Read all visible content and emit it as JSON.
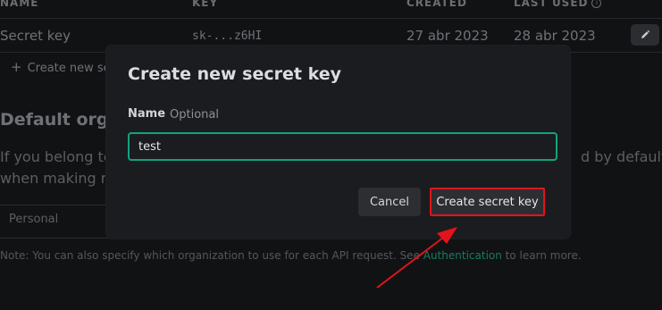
{
  "table": {
    "headers": {
      "name": "NAME",
      "key": "KEY",
      "created": "CREATED",
      "last_used": "LAST USED"
    },
    "rows": [
      {
        "name": "Secret key",
        "key": "sk-...z6HI",
        "created": "27 abr 2023",
        "last_used": "28 abr 2023"
      }
    ],
    "info_icon": "info-circle-icon",
    "edit_icon": "pencil-icon"
  },
  "create_link": {
    "label": "Create new se",
    "icon": "plus-icon"
  },
  "default_org": {
    "title": "Default organ",
    "text_line1_left": "If you belong to",
    "text_line1_right": "d by default",
    "text_line2_left": "when making rec",
    "selected": "Personal"
  },
  "note": {
    "prefix": "Note: You can also specify which organization to use for each API request. See ",
    "link": "Authentication",
    "suffix": " to learn more."
  },
  "modal": {
    "title": "Create new secret key",
    "name_label": "Name",
    "optional_label": "Optional",
    "name_value": "test",
    "cancel_label": "Cancel",
    "create_label": "Create secret key"
  },
  "colors": {
    "accent": "#10a37f",
    "highlight": "#e1141c",
    "background": "#111214",
    "modal": "#1b1c1f"
  }
}
